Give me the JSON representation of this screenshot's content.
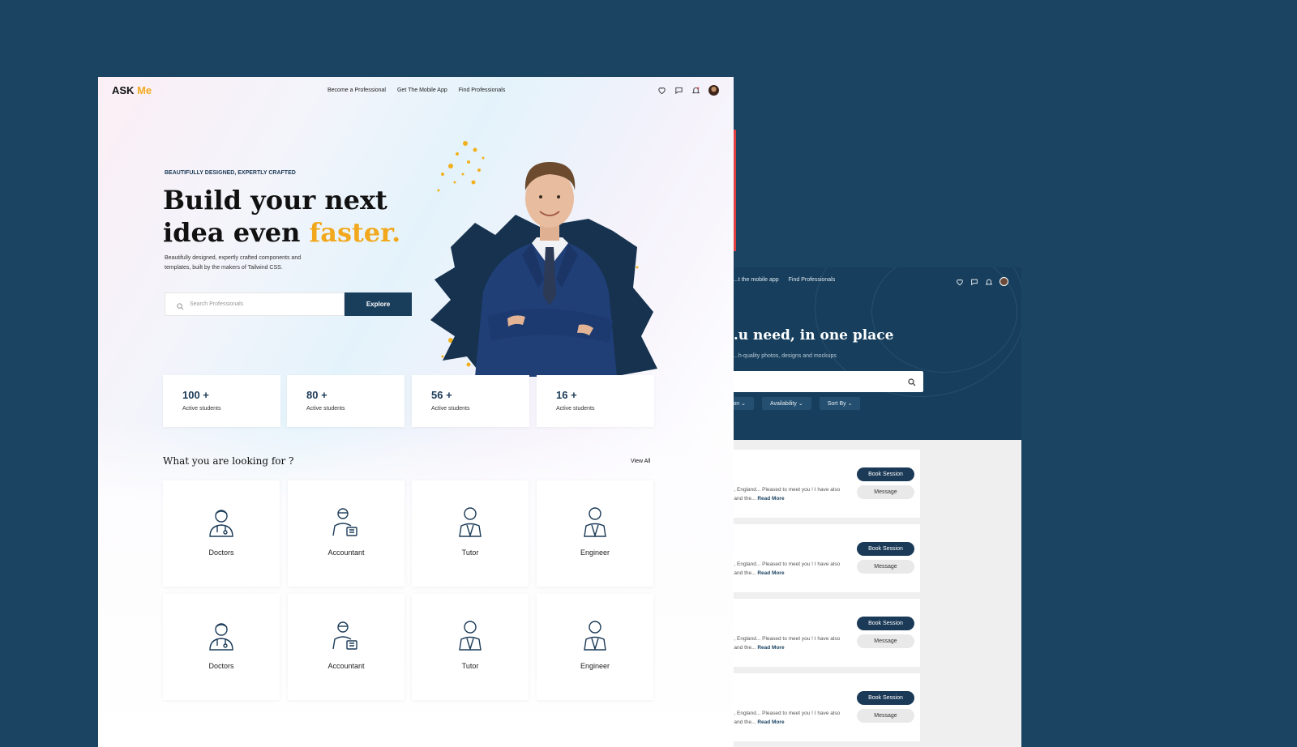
{
  "back_mockup": {
    "nav": [
      "...t the mobile app",
      "Find Professionals"
    ],
    "title": "...u need, in one place",
    "subtitle": "...h-quality photos, designs and mockups",
    "filters": [
      "...tion",
      "Availability",
      "Sort By"
    ],
    "card_text": "..., England... Pleased to meet you ! I have also ...and the...",
    "read_more": "Read More",
    "book_label": "Book Session",
    "message_label": "Message",
    "card_count": 4
  },
  "main": {
    "logo": {
      "part1": "ASK ",
      "part2": "Me"
    },
    "nav": {
      "become": "Become a Professional",
      "app": "Get The Mobile App",
      "find": "Find Professionals"
    },
    "hero": {
      "eyebrow": "BEAUTIFULLY DESIGNED, EXPERTLY CRAFTED",
      "headline_line1": "Build your next",
      "headline_line2_plain": "idea even ",
      "headline_line2_accent": "faster.",
      "lede": "Beautifully designed, expertly crafted components and templates, built by the makers of Tailwind CSS.",
      "search_placeholder": "Search Professionals",
      "explore_label": "Explore"
    },
    "stats": [
      {
        "value": "100 +",
        "label": "Active students"
      },
      {
        "value": "80 +",
        "label": "Active students"
      },
      {
        "value": "56 +",
        "label": "Active students"
      },
      {
        "value": "16 +",
        "label": "Active students"
      }
    ],
    "section_title": "What you are looking for ?",
    "view_all": "View All",
    "categories": [
      {
        "label": "Doctors",
        "icon": "doctor-icon"
      },
      {
        "label": "Accountant",
        "icon": "accountant-icon"
      },
      {
        "label": "Tutor",
        "icon": "tutor-icon"
      },
      {
        "label": "Engineer",
        "icon": "engineer-icon"
      },
      {
        "label": "Doctors",
        "icon": "doctor-icon"
      },
      {
        "label": "Accountant",
        "icon": "accountant-icon"
      },
      {
        "label": "Tutor",
        "icon": "tutor-icon"
      },
      {
        "label": "Engineer",
        "icon": "engineer-icon"
      }
    ]
  },
  "colors": {
    "background": "#1b4463",
    "navy": "#193e5c",
    "accent": "#f2a81d"
  }
}
